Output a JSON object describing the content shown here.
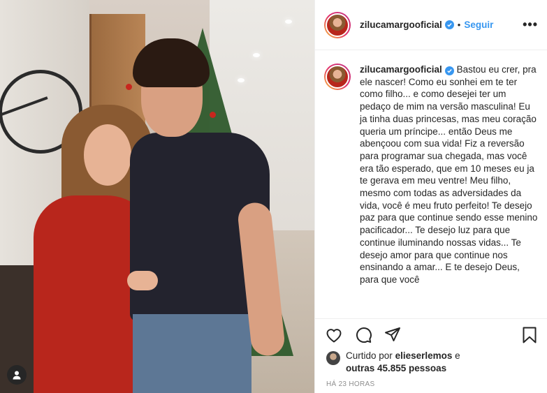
{
  "post": {
    "username": "zilucamargooficial",
    "follow_label": "Seguir",
    "separator": "•",
    "more_label": "•••",
    "verified": true,
    "caption": "Bastou eu crer, pra ele nascer! Como eu sonhei em te ter como filho... e como desejei ter um pedaço de mim na versão masculina! Eu ja tinha duas princesas, mas meu coração queria um príncipe... então Deus me abençoou com sua vida! Fiz a reversão para programar sua chegada, mas você era tão esperado, que em 10 meses eu ja te gerava em meu ventre! Meu filho, mesmo com todas as adversidades da vida, você é meu fruto perfeito! Te desejo paz para que continue sendo esse menino pacificador... Te desejo luz para que continue iluminando nossas vidas... Te desejo amor para que continue nos ensinando a amar... E te desejo Deus, para que você",
    "liked_by_prefix": "Curtido por",
    "liked_by_user": "elieserlemos",
    "liked_by_joiner": "e",
    "liked_by_others": "outras 45.855 pessoas",
    "timestamp": "HÁ 23 HORAS"
  },
  "icons": [
    "heart-icon",
    "comment-icon",
    "share-icon",
    "bookmark-icon",
    "verified-badge-icon",
    "user-tag-icon",
    "more-options-icon"
  ],
  "colors": {
    "link_blue": "#3897f0",
    "text": "#262626",
    "muted": "#8e8e8e",
    "border": "#efefef"
  }
}
